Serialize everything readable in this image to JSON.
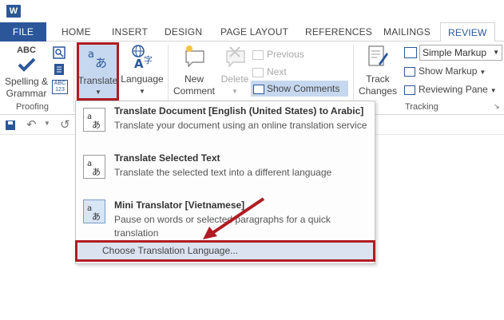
{
  "tabs": {
    "file": "FILE",
    "home": "HOME",
    "insert": "INSERT",
    "design": "DESIGN",
    "page_layout": "PAGE LAYOUT",
    "references": "REFERENCES",
    "mailings": "MAILINGS",
    "review": "REVIEW"
  },
  "ribbon": {
    "spelling_line1": "Spelling &",
    "spelling_line2": "Grammar",
    "proofing_label": "Proofing",
    "translate_label": "Translate",
    "language_label": "Language",
    "new_comment_line1": "New",
    "new_comment_line2": "Comment",
    "delete_label": "Delete",
    "previous_label": "Previous",
    "next_label": "Next",
    "show_comments_label": "Show Comments",
    "track_changes_line1": "Track",
    "track_changes_line2": "Changes",
    "markup_select_value": "Simple Markup",
    "show_markup_label": "Show Markup",
    "reviewing_pane_label": "Reviewing Pane",
    "tracking_label": "Tracking",
    "abc_label": "ABC",
    "abc_small_label": "ABC",
    "count_label": "123"
  },
  "menu": {
    "items": [
      {
        "title": "Translate Document [English (United States) to Arabic]",
        "description": "Translate your document using an online translation service"
      },
      {
        "title": "Translate Selected Text",
        "description": "Translate the selected text into a different language"
      },
      {
        "title": "Mini Translator [Vietnamese]",
        "description": "Pause on words or selected paragraphs for a quick translation"
      }
    ],
    "footer": "Choose Translation Language..."
  },
  "app_icon_letter": "W",
  "colors": {
    "accent": "#2b579a",
    "highlight": "#b01c22",
    "selected": "#c5d8ef"
  }
}
